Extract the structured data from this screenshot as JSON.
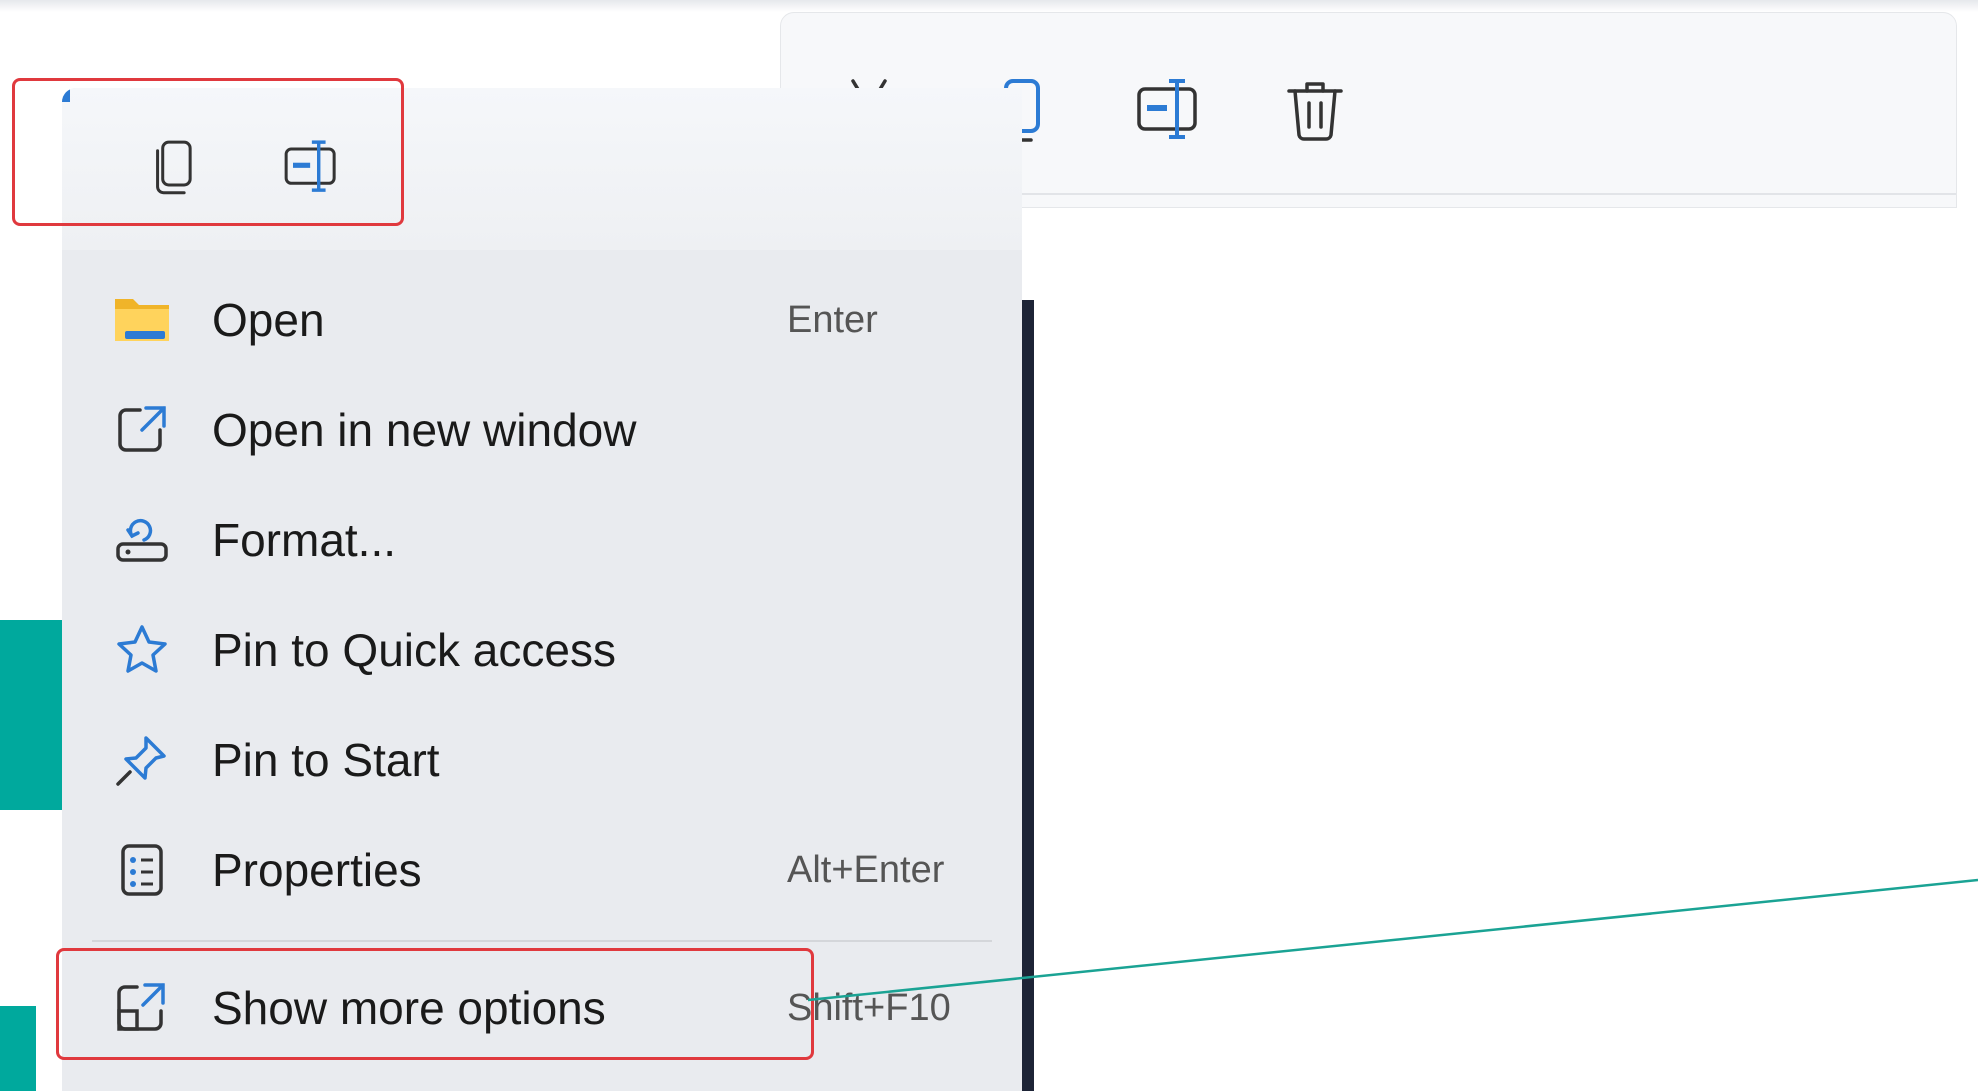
{
  "context_menu": {
    "toolbar_icons": [
      "copy-icon",
      "rename-icon"
    ],
    "items": [
      {
        "label": "Open",
        "shortcut": "Enter",
        "icon": "folder-icon"
      },
      {
        "label": "Open in new window",
        "shortcut": "",
        "icon": "open-new-window-icon"
      },
      {
        "label": "Format...",
        "shortcut": "",
        "icon": "format-drive-icon"
      },
      {
        "label": "Pin to Quick access",
        "shortcut": "",
        "icon": "star-icon"
      },
      {
        "label": "Pin to Start",
        "shortcut": "",
        "icon": "pin-icon"
      },
      {
        "label": "Properties",
        "shortcut": "Alt+Enter",
        "icon": "properties-icon"
      },
      {
        "label": "Show more options",
        "shortcut": "Shift+F10",
        "icon": "show-more-icon"
      }
    ]
  },
  "toolbar_panel": {
    "icons": [
      "cut-icon",
      "copy-icon",
      "rename-icon",
      "delete-icon"
    ]
  },
  "colors": {
    "accent_blue": "#2c7bd4",
    "highlight_red": "#e0393e",
    "teal": "#00a99d"
  }
}
